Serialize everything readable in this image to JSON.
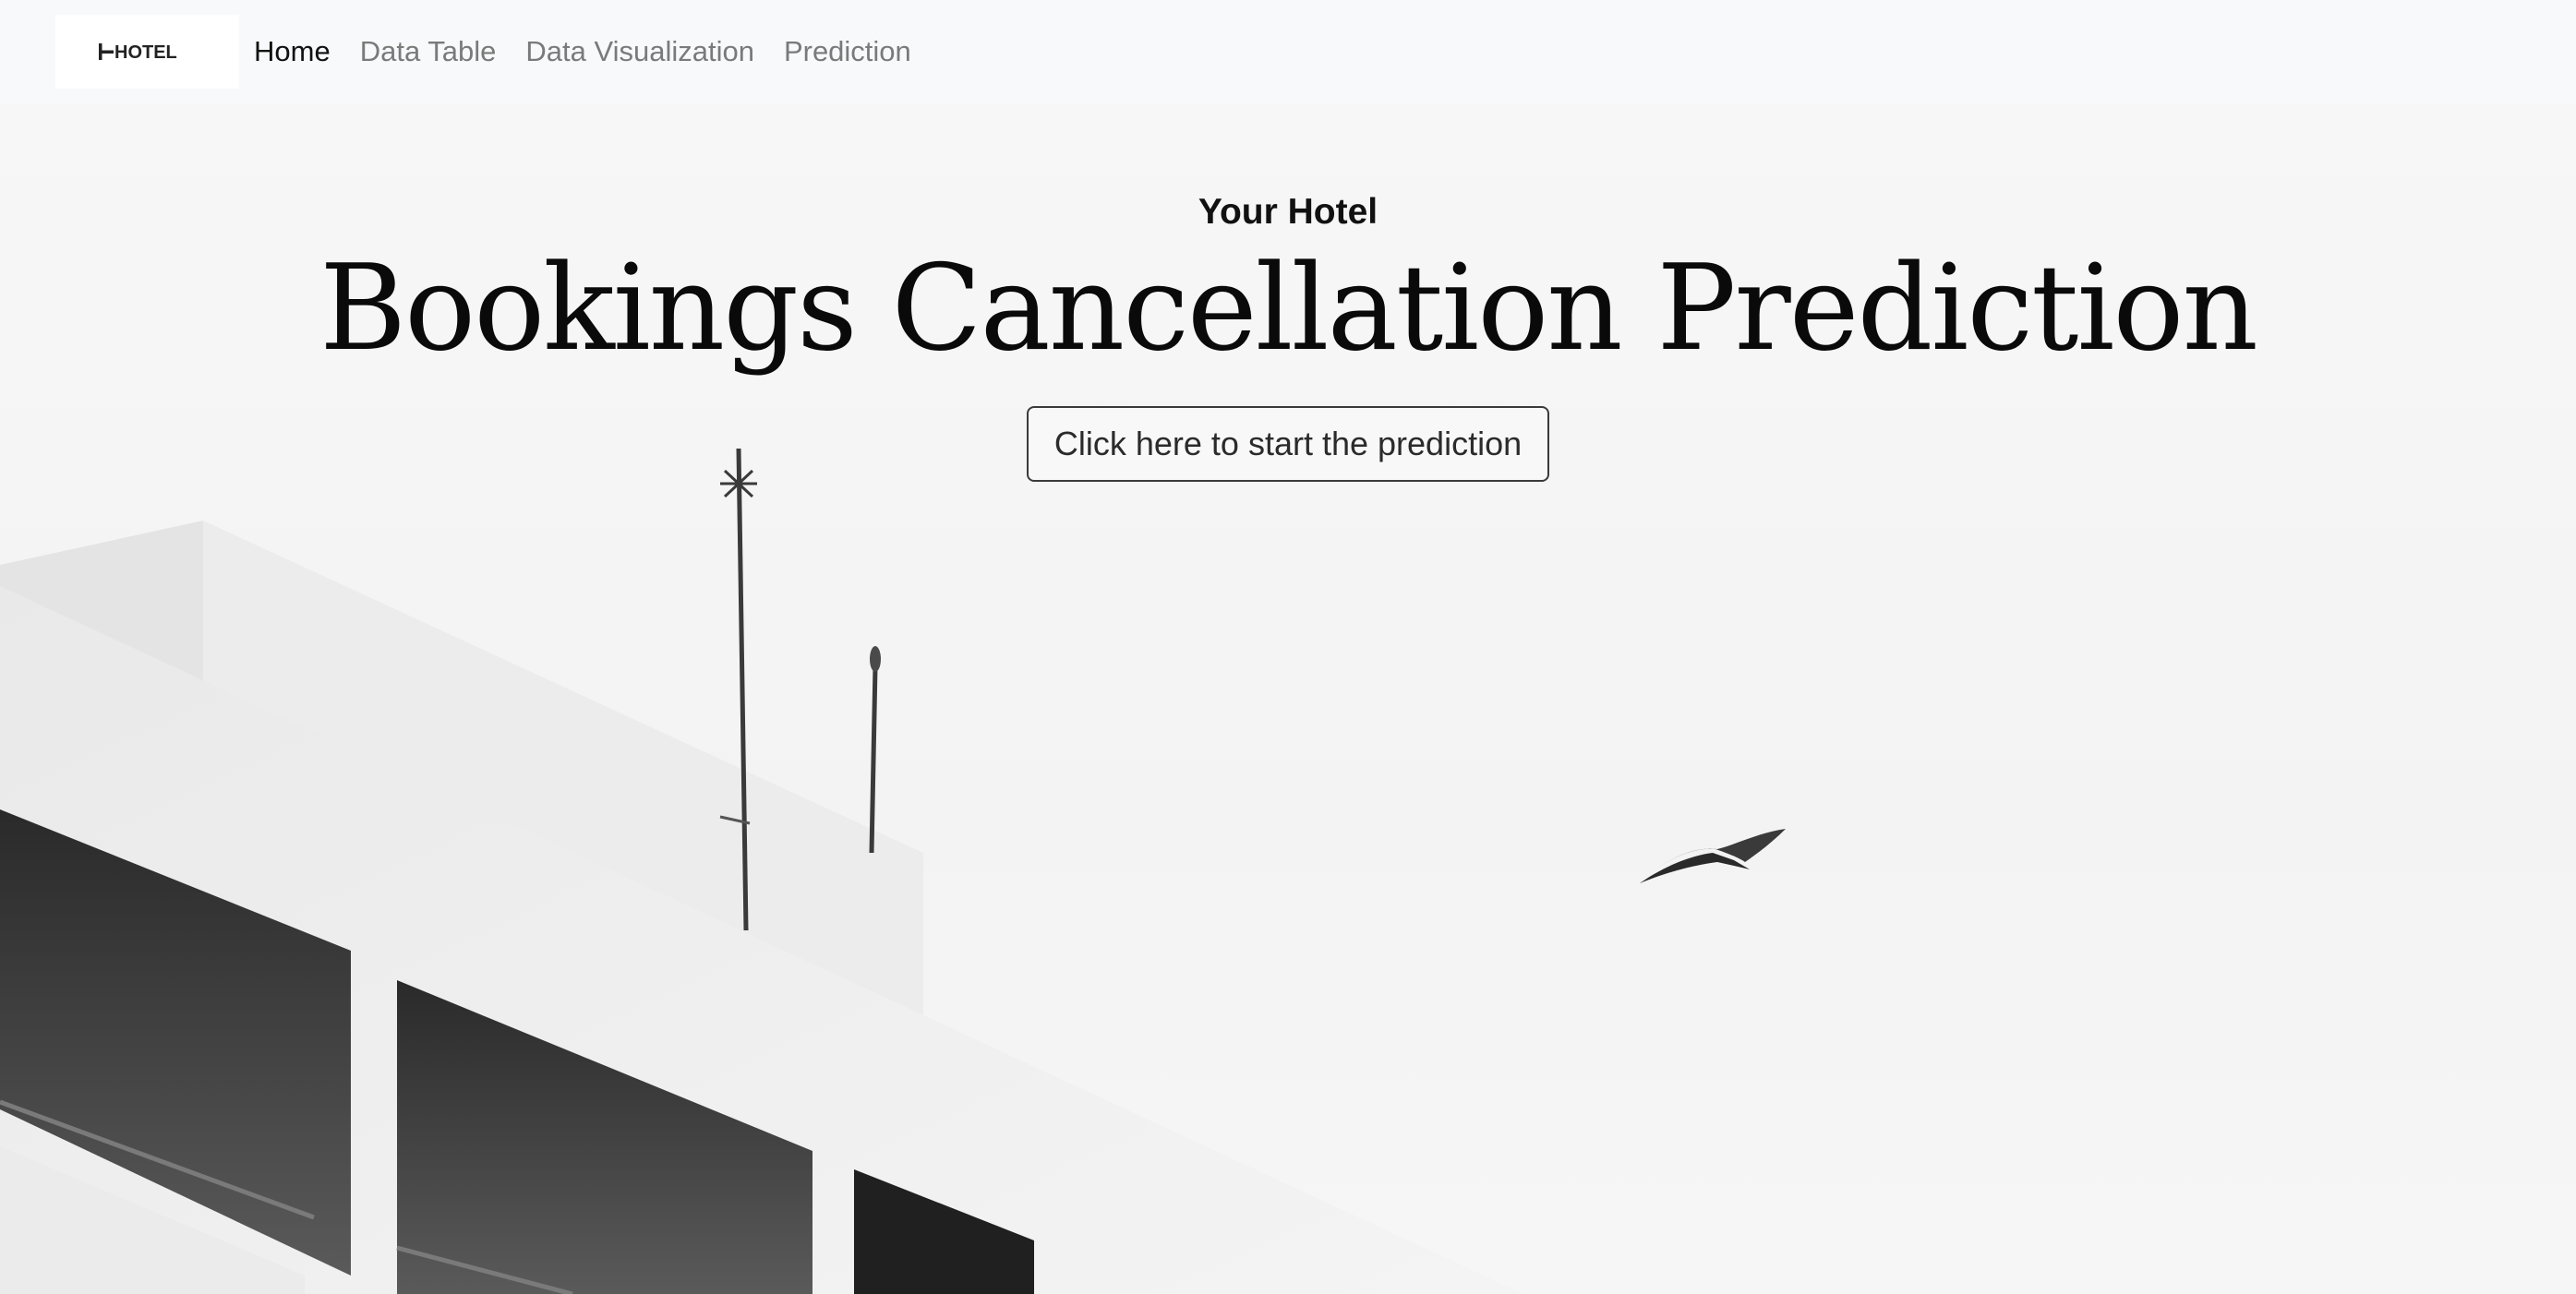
{
  "navbar": {
    "brand_logo": "HOTEL",
    "links": [
      {
        "label": "Home",
        "active": true
      },
      {
        "label": "Data Table",
        "active": false
      },
      {
        "label": "Data Visualization",
        "active": false
      },
      {
        "label": "Prediction",
        "active": false
      }
    ]
  },
  "hero": {
    "subtitle": "Your Hotel",
    "title": "Bookings Cancellation Prediction",
    "cta_label": "Click here to start the prediction",
    "background_image": "white-hotel-building-with-antennas-and-flying-bird"
  },
  "colors": {
    "navbar_bg": "#f8f9fa",
    "active_link": "#111111",
    "inactive_link": "#7a7a7a",
    "title_text": "#0a0a0a"
  }
}
